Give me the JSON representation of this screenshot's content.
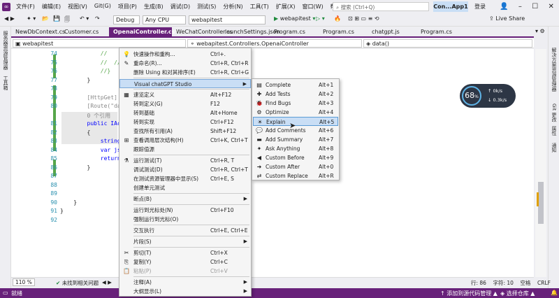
{
  "menubar": {
    "items": [
      "文件(F)",
      "编辑(E)",
      "视图(V)",
      "Git(G)",
      "项目(P)",
      "生成(B)",
      "调试(D)",
      "测试(S)",
      "分析(N)",
      "工具(T)",
      "扩展(X)",
      "窗口(W)",
      "帮助(H)"
    ],
    "search_placeholder": "搜索 (Ctrl+Q)",
    "app_name": "Con...App1",
    "login": "登录"
  },
  "toolbar": {
    "config": "Debug",
    "platform": "Any CPU",
    "project": "webapitest",
    "run_label": "webapitest",
    "live_share": "Live Share"
  },
  "left_strip": [
    "服务器资源管理器",
    "工具箱"
  ],
  "right_strip": [
    "解决方案资源管理器",
    "Git 更改",
    "属性",
    "通知"
  ],
  "tabs": [
    "NewDbContext.cs",
    "Customer.cs",
    "OpenaiController.cs*",
    "WeChatController.cs",
    "launchSettings.json",
    "Program.cs",
    "Program.cs",
    "chatgpt.js",
    "Program.cs"
  ],
  "navbar": {
    "project": "webapitest",
    "class": "webapitest.Controllers.OpenaiController",
    "member": "data()"
  },
  "editor": {
    "lines": [
      {
        "n": "74",
        "code": "            //    re"
      },
      {
        "n": "75",
        "code": "            //  //"
      },
      {
        "n": "76",
        "code": "            //}"
      },
      {
        "n": "77",
        "code": "        }"
      },
      {
        "n": "78",
        "code": ""
      },
      {
        "n": "79",
        "code": "        [HttpGet]"
      },
      {
        "n": "80",
        "code": "        [Route(\"data"
      },
      {
        "n": "",
        "code": "        0 个引用"
      },
      {
        "n": "81",
        "code": "        public IActi"
      },
      {
        "n": "82",
        "code": "        {"
      },
      {
        "n": "83",
        "code": "            string k"
      },
      {
        "n": "84",
        "code": "            var json"
      },
      {
        "n": "85",
        "code": "            return C"
      },
      {
        "n": "86",
        "code": "        }"
      },
      {
        "n": "87",
        "code": ""
      },
      {
        "n": "88",
        "code": ""
      },
      {
        "n": "89",
        "code": ""
      },
      {
        "n": "90",
        "code": "    }"
      },
      {
        "n": "91",
        "code": "}"
      },
      {
        "n": "92",
        "code": ""
      }
    ]
  },
  "context_menu": [
    {
      "icon": "💡",
      "label": "快速操作和重构...",
      "key": "Ctrl+."
    },
    {
      "icon": "✎",
      "label": "重命名(R)...",
      "key": "Ctrl+R, Ctrl+R"
    },
    {
      "icon": "",
      "label": "删除 Using 和对其排序(E)",
      "key": "Ctrl+R, Ctrl+G"
    },
    {
      "icon": "",
      "label": "Visual chatGPT Studio",
      "key": "",
      "submenu": true,
      "highlight": true
    },
    {
      "icon": "▦",
      "label": "速览定义",
      "key": "Alt+F12"
    },
    {
      "icon": "",
      "label": "转到定义(G)",
      "key": "F12"
    },
    {
      "icon": "",
      "label": "转到基础",
      "key": "Alt+Home"
    },
    {
      "icon": "",
      "label": "转到实现",
      "key": "Ctrl+F12"
    },
    {
      "icon": "",
      "label": "查找所有引用(A)",
      "key": "Shift+F12"
    },
    {
      "icon": "⊞",
      "label": "查看调用层次结构(H)",
      "key": "Ctrl+K, Ctrl+T"
    },
    {
      "icon": "",
      "label": "跟踪值源",
      "key": ""
    },
    {
      "icon": "⚗",
      "label": "运行测试(T)",
      "key": "Ctrl+R, T"
    },
    {
      "icon": "",
      "label": "调试测试(D)",
      "key": "Ctrl+R, Ctrl+T"
    },
    {
      "icon": "",
      "label": "在测试资源管理器中显示(S)",
      "key": "Ctrl+E, S"
    },
    {
      "icon": "",
      "label": "创建单元测试",
      "key": ""
    },
    {
      "icon": "",
      "label": "断点(B)",
      "key": "",
      "submenu": true
    },
    {
      "icon": "",
      "label": "运行到光标处(N)",
      "key": "Ctrl+F10"
    },
    {
      "icon": "",
      "label": "强制运行到光标(O)",
      "key": ""
    },
    {
      "icon": "",
      "label": "交互执行",
      "key": "Ctrl+E, Ctrl+E"
    },
    {
      "icon": "",
      "label": "片段(S)",
      "key": "",
      "submenu": true
    },
    {
      "icon": "✂",
      "label": "剪切(T)",
      "key": "Ctrl+X"
    },
    {
      "icon": "⎘",
      "label": "复制(Y)",
      "key": "Ctrl+C"
    },
    {
      "icon": "📋",
      "label": "粘贴(P)",
      "key": "Ctrl+V",
      "disabled": true
    },
    {
      "icon": "",
      "label": "注释(A)",
      "key": "",
      "submenu": true
    },
    {
      "icon": "",
      "label": "大纲显示(L)",
      "key": "",
      "submenu": true
    }
  ],
  "submenu": [
    {
      "icon": "▤",
      "label": "Complete",
      "key": "Alt+1"
    },
    {
      "icon": "✚",
      "label": "Add Tests",
      "key": "Alt+2"
    },
    {
      "icon": "🐞",
      "label": "Find Bugs",
      "key": "Alt+3"
    },
    {
      "icon": "⚙",
      "label": "Optimize",
      "key": "Alt+4"
    },
    {
      "icon": "☀",
      "label": "Explain",
      "key": "Alt+5",
      "highlight": true
    },
    {
      "icon": "💬",
      "label": "Add Comments",
      "key": "Alt+6"
    },
    {
      "icon": "▬",
      "label": "Add Summary",
      "key": "Alt+7"
    },
    {
      "icon": "✦",
      "label": "Ask Anything",
      "key": "Alt+8"
    },
    {
      "icon": "◀",
      "label": "Custom Before",
      "key": "Alt+9"
    },
    {
      "icon": "➜",
      "label": "Custom After",
      "key": "Alt+0"
    },
    {
      "icon": "⇄",
      "label": "Custom Replace",
      "key": "Alt+R"
    }
  ],
  "perf": {
    "cpu": "68",
    "unit": "%",
    "up": "0k/s",
    "down": "0.3k/s"
  },
  "zoombar": {
    "zoom": "110 %",
    "issues": "未找到相关问题",
    "position": "行: 86    字符: 10    空格    CRLF"
  },
  "statusbar": {
    "ready": "就绪",
    "source_control": "添加到源代码管理",
    "repo": "选择仓库"
  }
}
